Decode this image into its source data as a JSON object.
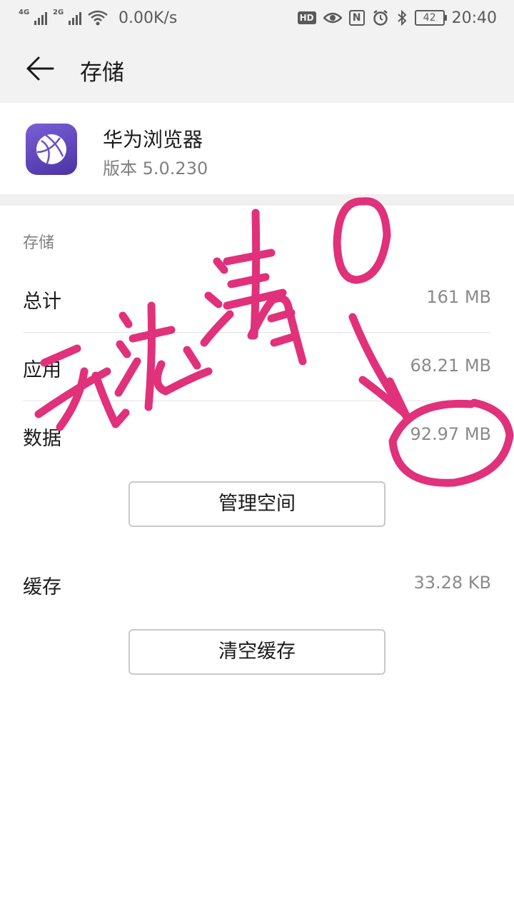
{
  "status_bar": {
    "sim1_label": "4G",
    "sim2_label": "2G",
    "net_speed": "0.00K/s",
    "hd_label": "HD",
    "nfc_label": "N",
    "battery": "42",
    "time": "20:40",
    "icons": [
      "signal-icon",
      "wifi-icon",
      "eye-comfort-icon",
      "nfc-icon",
      "alarm-icon",
      "bluetooth-icon",
      "battery-icon"
    ]
  },
  "header": {
    "title": "存储",
    "back_icon": "back-arrow-icon"
  },
  "app": {
    "name": "华为浏览器",
    "version": "版本 5.0.230",
    "icon": "browser-globe-icon",
    "icon_color": "#5f45c2"
  },
  "storage": {
    "section_title": "存储",
    "rows": [
      {
        "label": "总计",
        "value": "161 MB"
      },
      {
        "label": "应用",
        "value": "68.21 MB"
      },
      {
        "label": "数据",
        "value": "92.97 MB"
      }
    ],
    "manage_button": "管理空间"
  },
  "cache": {
    "label": "缓存",
    "value": "33.28 KB",
    "clear_button": "清空缓存"
  },
  "annotation": {
    "handwritten_text": "无法清0",
    "ink_color": "#e0317a"
  }
}
